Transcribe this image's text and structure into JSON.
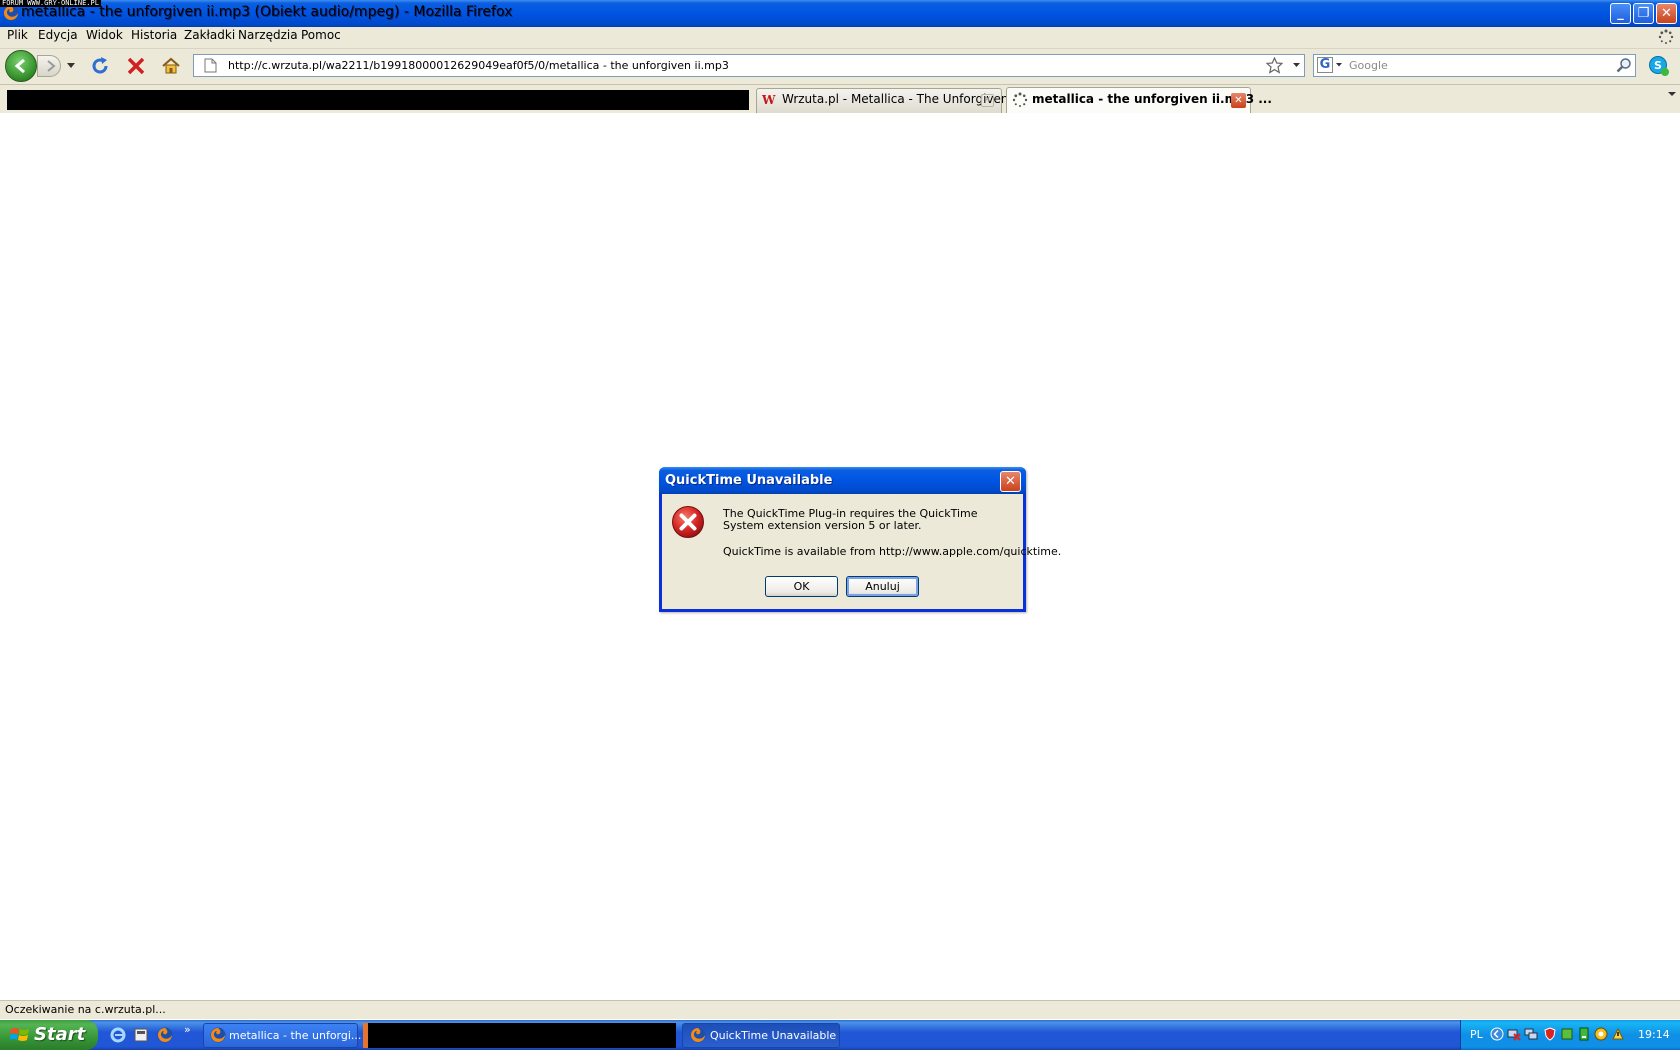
{
  "watermark": "FORUM WWW.GRY-ONLINE.PL",
  "window": {
    "title": "metallica - the unforgiven ii.mp3 (Obiekt audio/mpeg) - Mozilla Firefox"
  },
  "menu": {
    "items": [
      "Plik",
      "Edycja",
      "Widok",
      "Historia",
      "Zakładki",
      "Narzędzia",
      "Pomoc"
    ]
  },
  "navbar": {
    "url": "http://c.wrzuta.pl/wa2211/b19918000012629049eaf0f5/0/metallica - the unforgiven ii.mp3",
    "search_placeholder": "Google"
  },
  "tabs": [
    {
      "label": "Wrzuta.pl - Metallica - The Unforgiven II",
      "icon": "wrzuta-w-icon",
      "active": false
    },
    {
      "label": "metallica - the unforgiven ii.mp3 ...",
      "icon": "loading-icon",
      "active": true
    }
  ],
  "dialog": {
    "title": "QuickTime Unavailable",
    "line1": "The QuickTime Plug-in requires the QuickTime",
    "line2": "System extension version 5 or later.",
    "line3": "QuickTime is available from http://www.apple.com/quicktime.",
    "ok_label": "OK",
    "cancel_label": "Anuluj"
  },
  "status": {
    "text": "Oczekiwanie na c.wrzuta.pl..."
  },
  "taskbar": {
    "start_label": "Start",
    "quicklaunch_more": "»",
    "tasks": [
      {
        "label": "metallica - the unforgi..."
      },
      {
        "label": "QuickTime Unavailable"
      }
    ],
    "tray_lang": "PL",
    "clock": "19:14"
  },
  "colors": {
    "xp_blue": "#0054e3",
    "dialog_border": "#0831d9",
    "window_face": "#ece9d8",
    "error_red": "#d42424",
    "start_green": "#379637"
  }
}
